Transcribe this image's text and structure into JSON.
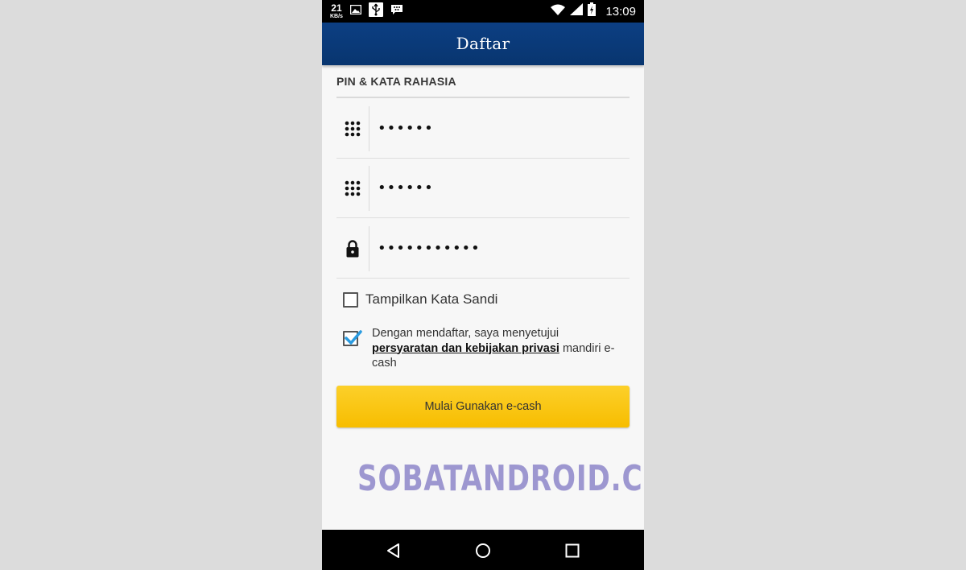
{
  "status_bar": {
    "speed_value": "21",
    "speed_unit": "KB/s",
    "time": "13:09"
  },
  "app_bar": {
    "title": "Daftar"
  },
  "section": {
    "title": "PIN & KATA RAHASIA"
  },
  "fields": [
    {
      "icon": "keypad-icon",
      "value": "••••••"
    },
    {
      "icon": "keypad-icon",
      "value": "••••••"
    },
    {
      "icon": "lock-icon",
      "value": "•••••••••••"
    }
  ],
  "show_password": {
    "label": "Tampilkan Kata Sandi",
    "checked": false
  },
  "agreement": {
    "text_before": "Dengan mendaftar, saya menyetujui ",
    "link_text": "persyaratan dan kebijakan privasi",
    "text_after": " mandiri e-cash",
    "checked": true
  },
  "cta": {
    "label": "Mulai Gunakan e-cash"
  },
  "watermark": {
    "text": "SOBATANDROID.COM"
  },
  "colors": {
    "app_bar": "#0a3a7c",
    "cta": "#fbc514",
    "watermark": "#9d97d0",
    "checkbox_check": "#2a9be0"
  }
}
